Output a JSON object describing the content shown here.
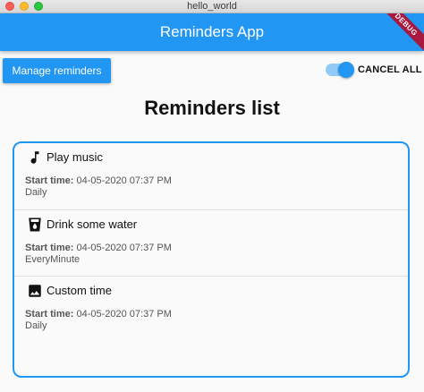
{
  "window": {
    "title": "hello_world"
  },
  "appbar": {
    "title": "Reminders App",
    "debug_banner": "DEBUG"
  },
  "toolbar": {
    "manage_label": "Manage reminders",
    "cancel_all_label": "CANCEL ALL"
  },
  "page": {
    "title": "Reminders list"
  },
  "reminders": [
    {
      "icon": "music-note-icon",
      "title": "Play music",
      "start_label": "Start time:",
      "start_value": "04-05-2020 07:37 PM",
      "repeat": "Daily"
    },
    {
      "icon": "water-glass-icon",
      "title": "Drink some water",
      "start_label": "Start time:",
      "start_value": "04-05-2020 07:37 PM",
      "repeat": "EveryMinute"
    },
    {
      "icon": "image-icon",
      "title": "Custom time",
      "start_label": "Start time:",
      "start_value": "04-05-2020 07:37 PM",
      "repeat": "Daily"
    }
  ],
  "colors": {
    "primary": "#2196f3",
    "toggle_track": "#90caf9",
    "debug": "#a8183f"
  }
}
